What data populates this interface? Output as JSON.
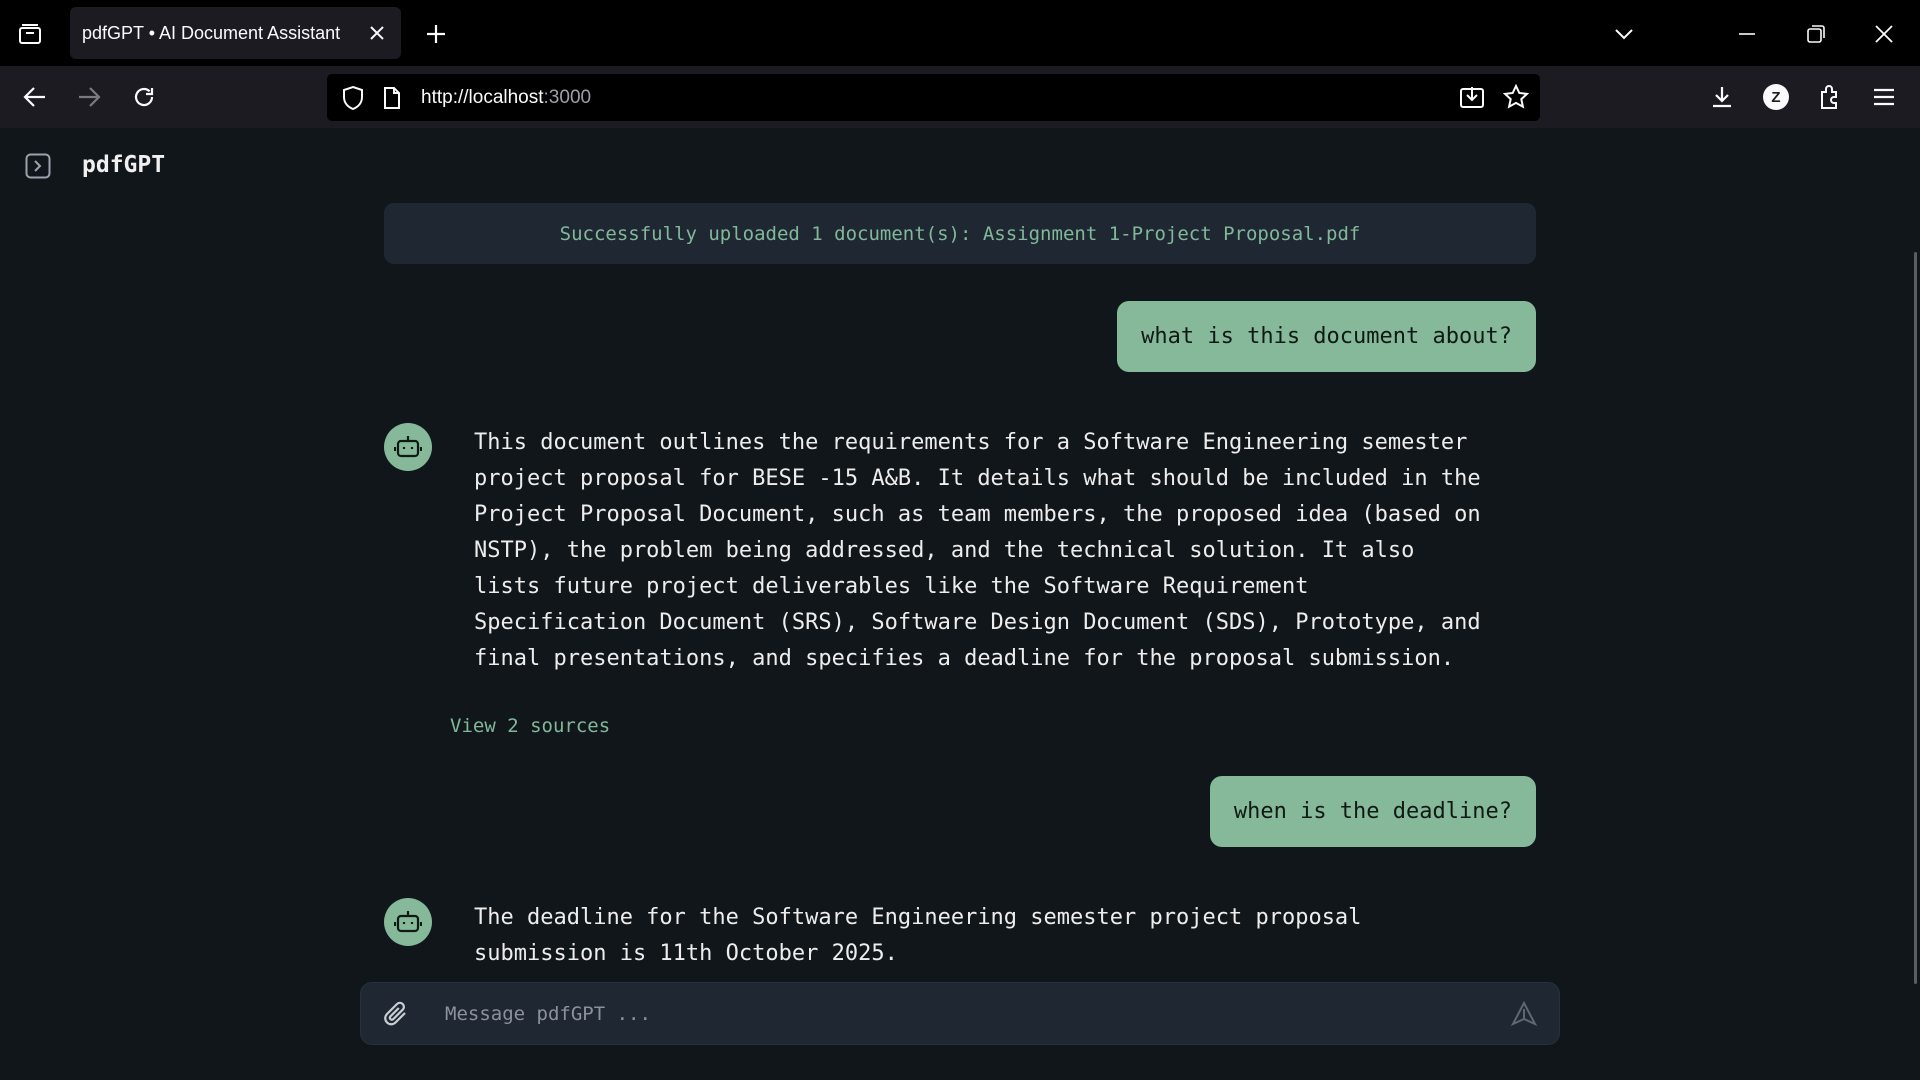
{
  "browser": {
    "tab_title": "pdfGPT • AI Document Assistant",
    "url_host": "http://localhost",
    "url_port": ":3000",
    "profile_initial": "Z"
  },
  "app": {
    "brand": "pdfGPT",
    "accent_color": "#86b99a",
    "upload_banner": "Successfully uploaded 1 document(s): Assignment 1-Project Proposal.pdf",
    "messages": [
      {
        "role": "user",
        "text": "what is this document about?"
      },
      {
        "role": "assistant",
        "text": "This document outlines the requirements for a Software Engineering semester\nproject proposal for BESE -15 A&B. It details what should be included in the\nProject Proposal Document, such as team members, the proposed idea (based on\nNSTP), the problem being addressed, and the technical solution. It also\nlists future project deliverables like the Software Requirement\nSpecification Document (SRS), Software Design Document (SDS), Prototype, and\nfinal presentations, and specifies a deadline for the proposal submission.",
        "sources_label": "View 2 sources"
      },
      {
        "role": "user",
        "text": "when is the deadline?"
      },
      {
        "role": "assistant",
        "text": "The deadline for the Software Engineering semester project proposal\nsubmission is 11th October 2025."
      }
    ],
    "composer": {
      "placeholder": "Message pdfGPT ...",
      "value": ""
    }
  }
}
